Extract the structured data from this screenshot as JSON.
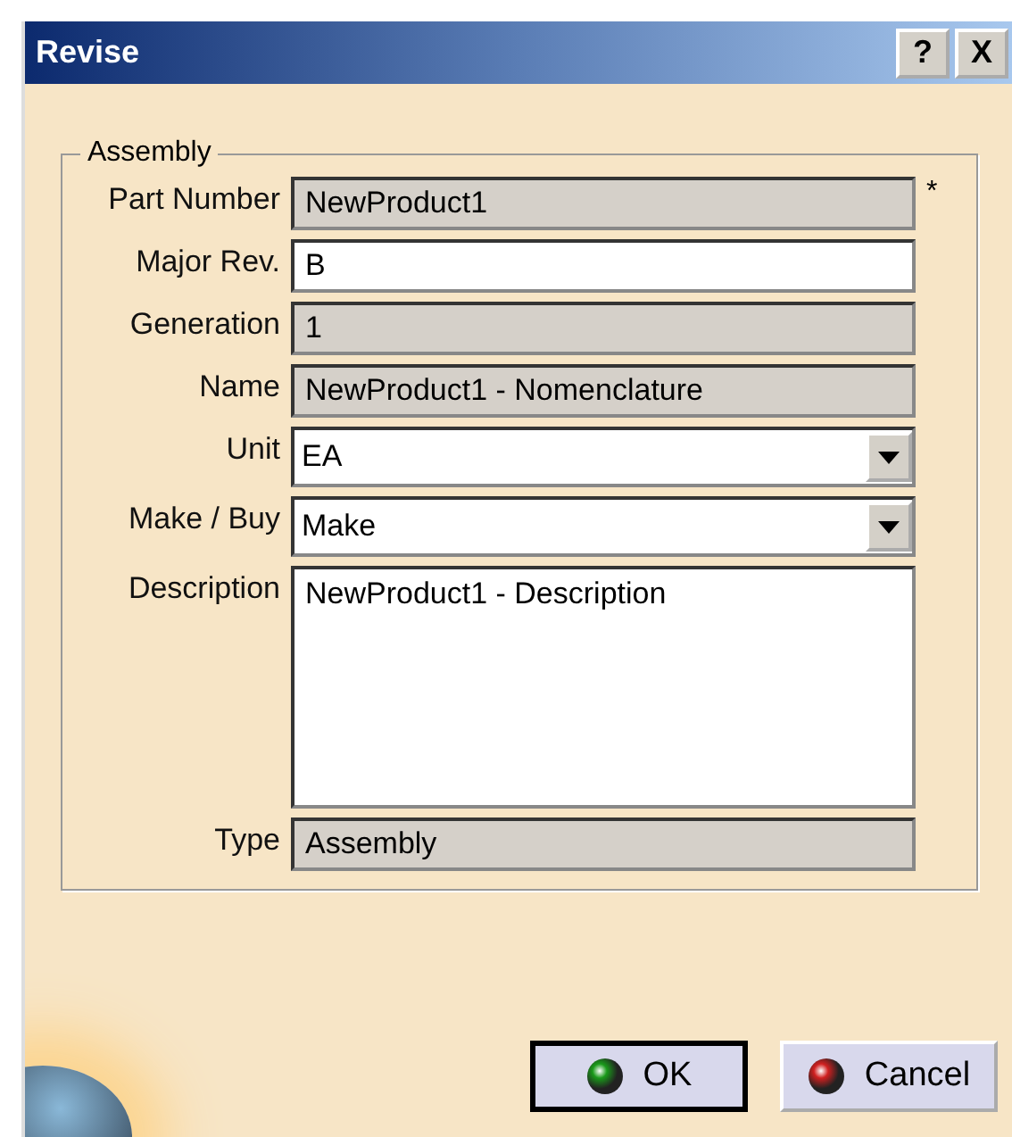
{
  "window": {
    "title": "Revise",
    "buttons": [
      "?",
      "X"
    ]
  },
  "group": {
    "title": "Assembly"
  },
  "fields": [
    {
      "label": "Part Number",
      "kind": "text",
      "value": "NewProduct1",
      "editable": false,
      "required_mark": "*"
    },
    {
      "label": "Major Rev.",
      "kind": "text",
      "value": "B",
      "editable": true
    },
    {
      "label": "Generation",
      "kind": "text",
      "value": "1",
      "editable": false
    },
    {
      "label": "Name",
      "kind": "text",
      "value": "NewProduct1 - Nomenclature",
      "editable": false
    },
    {
      "label": "Unit",
      "kind": "combo",
      "value": "EA"
    },
    {
      "label": "Make / Buy",
      "kind": "combo",
      "value": "Make"
    },
    {
      "label": "Description",
      "kind": "multiline",
      "value": "NewProduct1 - Description",
      "editable": true
    },
    {
      "label": "Type",
      "kind": "text",
      "value": "Assembly",
      "editable": false
    }
  ],
  "actions": [
    {
      "label": "OK",
      "kind": "ok",
      "default": true
    },
    {
      "label": "Cancel",
      "kind": "cancel",
      "default": false
    }
  ]
}
